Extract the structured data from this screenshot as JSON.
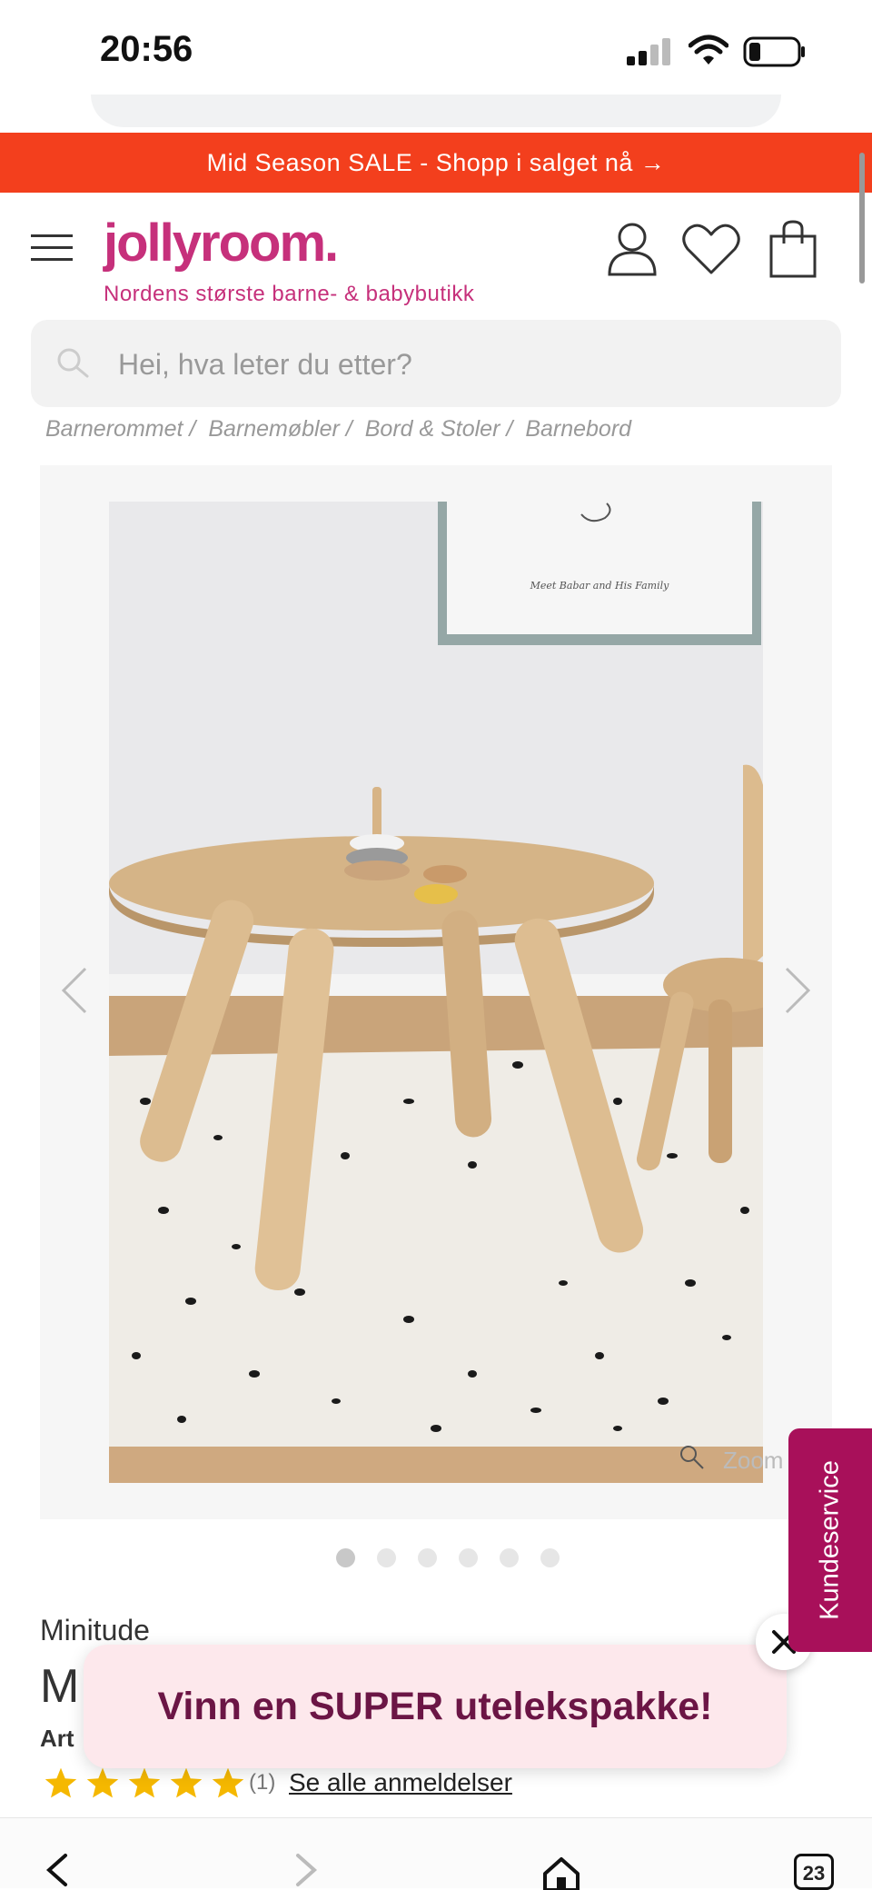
{
  "status_bar": {
    "time": "20:56"
  },
  "sale_banner": {
    "text": "Mid Season SALE - Shopp i salget nå →"
  },
  "header": {
    "logo": "jollyroom.",
    "tagline": "Nordens største barne- & babybutikk"
  },
  "search": {
    "placeholder": "Hei, hva leter du etter?"
  },
  "breadcrumb": [
    "Barnerommet /",
    "Barnemøbler /",
    "Bord & Stoler /",
    "Barnebord"
  ],
  "gallery": {
    "zoom_label": "Zoom",
    "image_count": 6,
    "active_index": 0,
    "print_caption": "Meet Babar and His Family"
  },
  "product": {
    "brand": "Minitude",
    "title_partial": "M",
    "article_partial": "Art",
    "rating": 5,
    "review_count": "(1)",
    "reviews_link": "Se alle anmeldelser"
  },
  "popup": {
    "text": "Vinn en SUPER utelekspakke!"
  },
  "customer_service": {
    "label": "Kundeservice"
  },
  "browser": {
    "tab_count": "23"
  },
  "colors": {
    "sale": "#f33f1d",
    "brand": "#c6307b",
    "service": "#a8105a",
    "popup_bg": "#fde8ec",
    "popup_text": "#6b1545",
    "star": "#f5b800"
  }
}
